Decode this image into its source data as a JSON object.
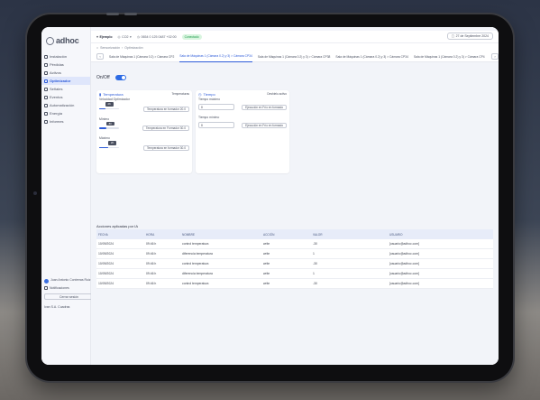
{
  "sidebar": {
    "logo": "adhoc",
    "items": [
      {
        "label": "Instalación"
      },
      {
        "label": "Pérdidas"
      },
      {
        "label": "Activos"
      },
      {
        "label": "Optimizador"
      },
      {
        "label": "Señales"
      },
      {
        "label": "Eventos"
      },
      {
        "label": "Automatización"
      },
      {
        "label": "Energía"
      },
      {
        "label": "Informes"
      }
    ],
    "active_item": "Optimizador",
    "user": "Juan Antonio Contreras Ruiz",
    "notifications": "Notificaciones",
    "logout": "Cerrar sesión",
    "brand": "Ivan S.A. Cuadras"
  },
  "topbar": {
    "site": "Ejemplo",
    "co2": "CO2",
    "phone": "0654 0 125 0487 +02:00",
    "status": "Conectado",
    "date": "27 de Septiembre 2024"
  },
  "breadcrumb": {
    "root": "Sensorización",
    "current": "Optimización"
  },
  "tabs": [
    "Sala de Máquinas 1 (Cámara 0.2) > Cámara CP2",
    "Sala de Máquinas 1 (Cámara 0.2) y 3) > Cámara CP34",
    "Sala de Máquinas 1 (Cámara 0.2) y 3) > Cámara CP38",
    "Sala de Máquinas 1 (Cámara 0.2) y 3) > Cámara CP34",
    "Sala de Máquinas 1 (Cámara 0.2) y 3) > Cámara CP4",
    "Sala de Máquinas 3 ("
  ],
  "active_tab": 1,
  "onoff_label": "On/Off",
  "temperature_card": {
    "title": "Temperatura",
    "subtitle": "Temperaturas",
    "sliders": [
      {
        "label": "Velocidad Optimizador",
        "value": "26",
        "fill": 0.3,
        "button": "Temperatura en formador 20.0"
      },
      {
        "label": "Mínimo",
        "value": "80",
        "fill": 0.35,
        "button": "Temperatura en Formador 30.0"
      },
      {
        "label": "Máximo",
        "value": "26",
        "fill": 0.45,
        "button": "Temperatura en formador 30.0"
      }
    ]
  },
  "time_card": {
    "title": "Tiempo",
    "subtitle": "Deshielo activo",
    "field1_label": "Tiempo máximo",
    "field1_value": "0",
    "field1_button": "Ejecución en Frío en formado",
    "field2_label": "Tiempo mínimo",
    "field2_value": "0",
    "field2_button": "Ejecución en Frío en formado"
  },
  "actions": {
    "title": "Acciones aplicadas por IA",
    "download": "Descargar",
    "headers": [
      "FECHA",
      "HORA",
      "NOMBRE",
      "ACCIÓN",
      "VALOR",
      "USUARIO"
    ],
    "rows": [
      [
        "10/09/2024",
        "09:46 h",
        "control temperatura",
        "write",
        "-30",
        "[usuario@adhoc.com]"
      ],
      [
        "10/09/2024",
        "09:46 h",
        "diferencia temperatura",
        "write",
        "1",
        "[usuario@adhoc.com]"
      ],
      [
        "10/09/2024",
        "09:46 h",
        "control temperatura",
        "write",
        "-30",
        "[usuario@adhoc.com]"
      ],
      [
        "10/09/2024",
        "09:46 h",
        "diferencia temperatura",
        "write",
        "1",
        "[usuario@adhoc.com]"
      ],
      [
        "10/09/2024",
        "09:46 h",
        "control temperatura",
        "write",
        "-30",
        "[usuario@adhoc.com]"
      ]
    ]
  }
}
